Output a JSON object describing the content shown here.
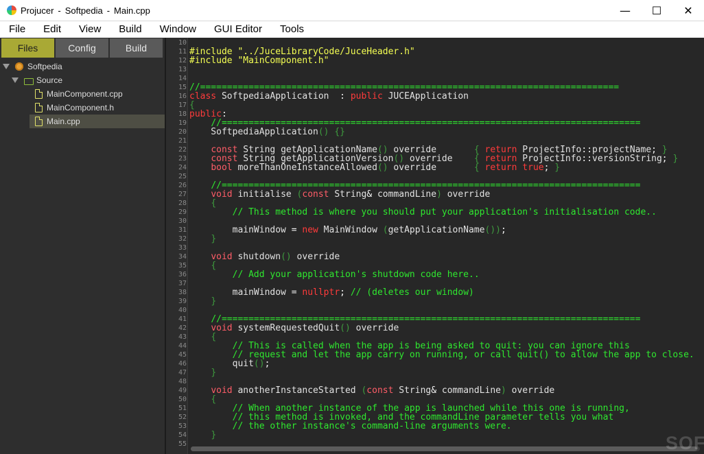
{
  "titlebar": {
    "parts": [
      "Projucer",
      "-",
      "Softpedia",
      "-",
      "Main.cpp"
    ],
    "controls": [
      {
        "name": "minimize",
        "glyph": "—"
      },
      {
        "name": "maximize",
        "glyph": "☐"
      },
      {
        "name": "close",
        "glyph": "✕"
      }
    ]
  },
  "menubar": [
    "File",
    "Edit",
    "View",
    "Build",
    "Window",
    "GUI Editor",
    "Tools"
  ],
  "sidebar": {
    "tabs": [
      "Files",
      "Config",
      "Build"
    ],
    "active_tab": "Files",
    "tree": {
      "project": "Softpedia",
      "folder": "Source",
      "files": [
        "MainComponent.cpp",
        "MainComponent.h",
        "Main.cpp"
      ],
      "selected_file": "Main.cpp"
    }
  },
  "colors": {
    "active_tab": "#a9a935",
    "preprocessor": "#f4ff53",
    "keyword": "#ff3b3b",
    "comment": "#2fe82f",
    "editor_bg": "#272727"
  },
  "watermark": "SOFTPEDIA",
  "code": [
    {
      "n": "10",
      "t": []
    },
    {
      "n": "11",
      "t": [
        [
          "pp",
          "#include \"../JuceLibraryCode/JuceHeader.h\""
        ]
      ]
    },
    {
      "n": "12",
      "t": [
        [
          "pp",
          "#include \"MainComponent.h\""
        ]
      ]
    },
    {
      "n": "13",
      "t": []
    },
    {
      "n": "14",
      "t": []
    },
    {
      "n": "15",
      "t": [
        [
          "cm",
          "//=============================================================================="
        ]
      ]
    },
    {
      "n": "16",
      "t": [
        [
          "kw",
          "class"
        ],
        [
          "id",
          " SoftpediaApplication  "
        ],
        [
          "op",
          ":"
        ],
        [
          "id",
          " "
        ],
        [
          "kw",
          "public"
        ],
        [
          "id",
          " JUCEApplication"
        ]
      ]
    },
    {
      "n": "17",
      "t": [
        [
          "br",
          "{"
        ]
      ]
    },
    {
      "n": "18",
      "t": [
        [
          "kw",
          "public"
        ],
        [
          "op",
          ":"
        ]
      ]
    },
    {
      "n": "19",
      "t": [
        [
          "id",
          "    "
        ],
        [
          "cm",
          "//=============================================================================="
        ]
      ]
    },
    {
      "n": "20",
      "t": [
        [
          "id",
          "    SoftpediaApplication"
        ],
        [
          "br",
          "() {}"
        ]
      ]
    },
    {
      "n": "21",
      "t": []
    },
    {
      "n": "22",
      "t": [
        [
          "id",
          "    "
        ],
        [
          "ty",
          "const"
        ],
        [
          "id",
          " String getApplicationName"
        ],
        [
          "br",
          "()"
        ],
        [
          "id",
          " override       "
        ],
        [
          "br",
          "{"
        ],
        [
          "id",
          " "
        ],
        [
          "kw",
          "return"
        ],
        [
          "id",
          " ProjectInfo"
        ],
        [
          "op",
          "::"
        ],
        [
          "id",
          "projectName"
        ],
        [
          "op",
          ";"
        ],
        [
          "id",
          " "
        ],
        [
          "br",
          "}"
        ]
      ]
    },
    {
      "n": "23",
      "t": [
        [
          "id",
          "    "
        ],
        [
          "ty",
          "const"
        ],
        [
          "id",
          " String getApplicationVersion"
        ],
        [
          "br",
          "()"
        ],
        [
          "id",
          " override    "
        ],
        [
          "br",
          "{"
        ],
        [
          "id",
          " "
        ],
        [
          "kw",
          "return"
        ],
        [
          "id",
          " ProjectInfo"
        ],
        [
          "op",
          "::"
        ],
        [
          "id",
          "versionString"
        ],
        [
          "op",
          ";"
        ],
        [
          "id",
          " "
        ],
        [
          "br",
          "}"
        ]
      ]
    },
    {
      "n": "24",
      "t": [
        [
          "id",
          "    "
        ],
        [
          "ty",
          "bool"
        ],
        [
          "id",
          " moreThanOneInstanceAllowed"
        ],
        [
          "br",
          "()"
        ],
        [
          "id",
          " override       "
        ],
        [
          "br",
          "{"
        ],
        [
          "id",
          " "
        ],
        [
          "kw",
          "return"
        ],
        [
          "id",
          " "
        ],
        [
          "kw",
          "true"
        ],
        [
          "op",
          ";"
        ],
        [
          "id",
          " "
        ],
        [
          "br",
          "}"
        ]
      ]
    },
    {
      "n": "25",
      "t": []
    },
    {
      "n": "26",
      "t": [
        [
          "id",
          "    "
        ],
        [
          "cm",
          "//=============================================================================="
        ]
      ]
    },
    {
      "n": "27",
      "t": [
        [
          "id",
          "    "
        ],
        [
          "ty",
          "void"
        ],
        [
          "id",
          " initialise "
        ],
        [
          "br",
          "("
        ],
        [
          "ty",
          "const"
        ],
        [
          "id",
          " String"
        ],
        [
          "op",
          "&"
        ],
        [
          "id",
          " commandLine"
        ],
        [
          "br",
          ")"
        ],
        [
          "id",
          " override"
        ]
      ]
    },
    {
      "n": "28",
      "t": [
        [
          "id",
          "    "
        ],
        [
          "br",
          "{"
        ]
      ]
    },
    {
      "n": "29",
      "t": [
        [
          "id",
          "        "
        ],
        [
          "cm",
          "// This method is where you should put your application's initialisation code.."
        ]
      ]
    },
    {
      "n": "30",
      "t": []
    },
    {
      "n": "31",
      "t": [
        [
          "id",
          "        mainWindow "
        ],
        [
          "op",
          "="
        ],
        [
          "id",
          " "
        ],
        [
          "kw",
          "new"
        ],
        [
          "id",
          " MainWindow "
        ],
        [
          "br",
          "("
        ],
        [
          "id",
          "getApplicationName"
        ],
        [
          "br",
          "())"
        ],
        [
          "op",
          ";"
        ]
      ]
    },
    {
      "n": "32",
      "t": [
        [
          "id",
          "    "
        ],
        [
          "br",
          "}"
        ]
      ]
    },
    {
      "n": "33",
      "t": []
    },
    {
      "n": "34",
      "t": [
        [
          "id",
          "    "
        ],
        [
          "ty",
          "void"
        ],
        [
          "id",
          " shutdown"
        ],
        [
          "br",
          "()"
        ],
        [
          "id",
          " override"
        ]
      ]
    },
    {
      "n": "35",
      "t": [
        [
          "id",
          "    "
        ],
        [
          "br",
          "{"
        ]
      ]
    },
    {
      "n": "36",
      "t": [
        [
          "id",
          "        "
        ],
        [
          "cm",
          "// Add your application's shutdown code here.."
        ]
      ]
    },
    {
      "n": "37",
      "t": []
    },
    {
      "n": "38",
      "t": [
        [
          "id",
          "        mainWindow "
        ],
        [
          "op",
          "="
        ],
        [
          "id",
          " "
        ],
        [
          "kw",
          "nullptr"
        ],
        [
          "op",
          ";"
        ],
        [
          "id",
          " "
        ],
        [
          "cm",
          "// (deletes our window)"
        ]
      ]
    },
    {
      "n": "39",
      "t": [
        [
          "id",
          "    "
        ],
        [
          "br",
          "}"
        ]
      ]
    },
    {
      "n": "40",
      "t": []
    },
    {
      "n": "41",
      "t": [
        [
          "id",
          "    "
        ],
        [
          "cm",
          "//=============================================================================="
        ]
      ]
    },
    {
      "n": "42",
      "t": [
        [
          "id",
          "    "
        ],
        [
          "ty",
          "void"
        ],
        [
          "id",
          " systemRequestedQuit"
        ],
        [
          "br",
          "()"
        ],
        [
          "id",
          " override"
        ]
      ]
    },
    {
      "n": "43",
      "t": [
        [
          "id",
          "    "
        ],
        [
          "br",
          "{"
        ]
      ]
    },
    {
      "n": "44",
      "t": [
        [
          "id",
          "        "
        ],
        [
          "cm",
          "// This is called when the app is being asked to quit: you can ignore this"
        ]
      ]
    },
    {
      "n": "45",
      "t": [
        [
          "id",
          "        "
        ],
        [
          "cm",
          "// request and let the app carry on running, or call quit() to allow the app to close."
        ]
      ]
    },
    {
      "n": "46",
      "t": [
        [
          "id",
          "        quit"
        ],
        [
          "br",
          "()"
        ],
        [
          "op",
          ";"
        ]
      ]
    },
    {
      "n": "47",
      "t": [
        [
          "id",
          "    "
        ],
        [
          "br",
          "}"
        ]
      ]
    },
    {
      "n": "48",
      "t": []
    },
    {
      "n": "49",
      "t": [
        [
          "id",
          "    "
        ],
        [
          "ty",
          "void"
        ],
        [
          "id",
          " anotherInstanceStarted "
        ],
        [
          "br",
          "("
        ],
        [
          "ty",
          "const"
        ],
        [
          "id",
          " String"
        ],
        [
          "op",
          "&"
        ],
        [
          "id",
          " commandLine"
        ],
        [
          "br",
          ")"
        ],
        [
          "id",
          " override"
        ]
      ]
    },
    {
      "n": "50",
      "t": [
        [
          "id",
          "    "
        ],
        [
          "br",
          "{"
        ]
      ]
    },
    {
      "n": "51",
      "t": [
        [
          "id",
          "        "
        ],
        [
          "cm",
          "// When another instance of the app is launched while this one is running,"
        ]
      ]
    },
    {
      "n": "52",
      "t": [
        [
          "id",
          "        "
        ],
        [
          "cm",
          "// this method is invoked, and the commandLine parameter tells you what"
        ]
      ]
    },
    {
      "n": "53",
      "t": [
        [
          "id",
          "        "
        ],
        [
          "cm",
          "// the other instance's command-line arguments were."
        ]
      ]
    },
    {
      "n": "54",
      "t": [
        [
          "id",
          "    "
        ],
        [
          "br",
          "}"
        ]
      ]
    },
    {
      "n": "55",
      "t": []
    }
  ]
}
